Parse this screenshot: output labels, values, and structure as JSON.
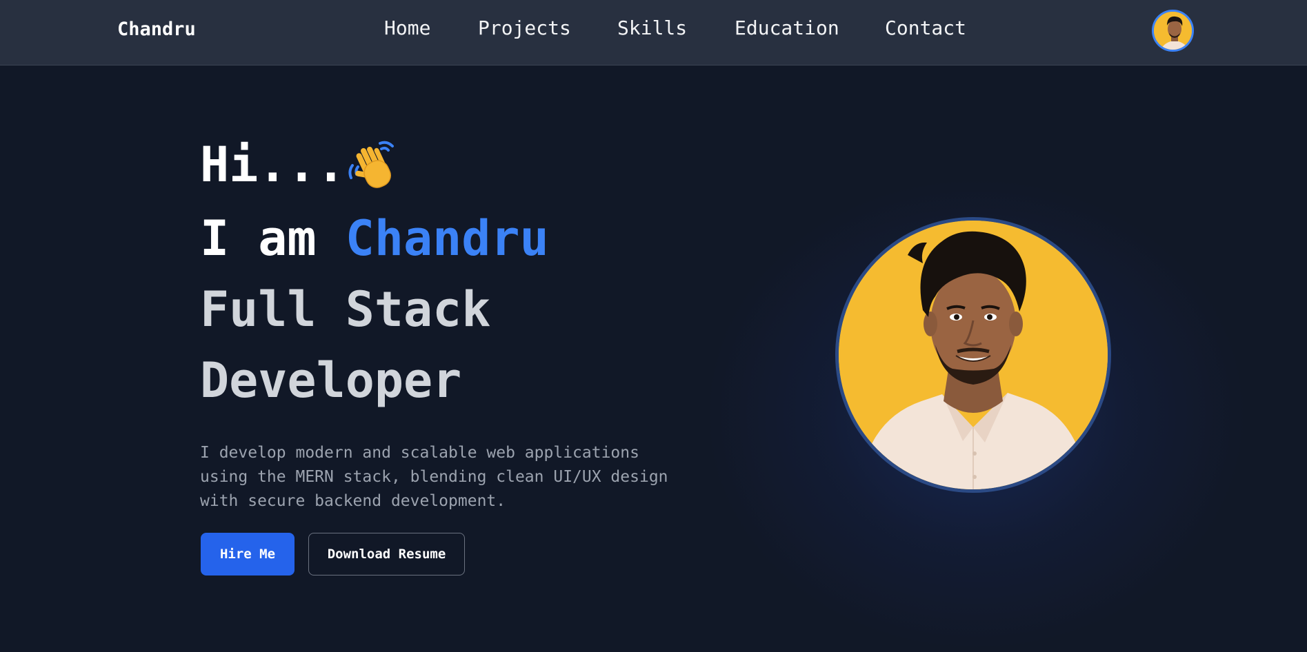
{
  "navbar": {
    "brand": "Chandru",
    "links": [
      "Home",
      "Projects",
      "Skills",
      "Education",
      "Contact"
    ]
  },
  "hero": {
    "greeting": "Hi...",
    "intro_prefix": "I am ",
    "name": "Chandru",
    "role_line1": "Full Stack",
    "role_line2": "Developer",
    "description": "I develop modern and scalable web applications using the MERN stack, blending clean UI/UX design with secure backend development.",
    "hire_button": "Hire Me",
    "resume_button": "Download Resume"
  },
  "icons": {
    "wave": "waving-hand-icon"
  },
  "colors": {
    "background": "#111827",
    "navbar": "#283040",
    "accent": "#3b82f6",
    "primary_button": "#2563eb",
    "portrait_background": "#f5bb30"
  }
}
